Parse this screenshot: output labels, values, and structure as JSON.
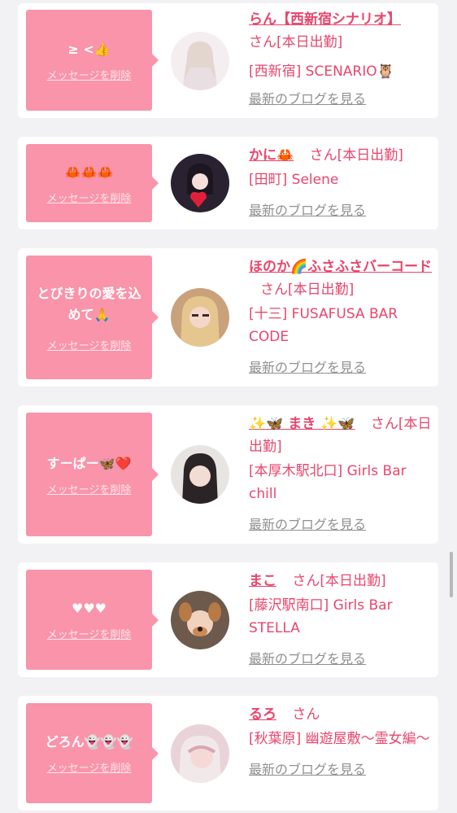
{
  "delete_label": "メッセージを削除",
  "blog_label": "最新のブログを見る",
  "san_label": "さん",
  "cards": [
    {
      "message": "≥ <👍",
      "name": "らん【西新宿シナリオ】",
      "status": "さん[本日出勤]",
      "shop": "[西新宿] SCENARIO🦉"
    },
    {
      "message": "🦀🦀🦀",
      "name": "かに🦀",
      "status": "さん[本日出勤]",
      "shop": "[田町] Selene"
    },
    {
      "message": "とびきりの愛を込めて🙏",
      "name": "ほのか🌈ふさふさバーコード",
      "status": "さん[本日出勤]",
      "shop": "[十三] FUSAFUSA BAR CODE"
    },
    {
      "message": "すーぱー🦋❤️",
      "name": "✨🦋 まき ✨🦋",
      "status": "さん[本日出勤]",
      "shop": "[本厚木駅北口] Girls Bar chill"
    },
    {
      "message": "♥♥♥",
      "name": "まこ",
      "status": "さん[本日出勤]",
      "shop": "[藤沢駅南口] Girls Bar STELLA"
    },
    {
      "message": "どろん👻👻👻",
      "name": "るろ",
      "status": "さん",
      "shop": "[秋葉原] 幽遊屋敷〜霊女編〜"
    }
  ],
  "colors": {
    "bubble": "#f994aa",
    "accent": "#e8466c",
    "link_gray": "#909090",
    "background": "#f2f1f3"
  }
}
